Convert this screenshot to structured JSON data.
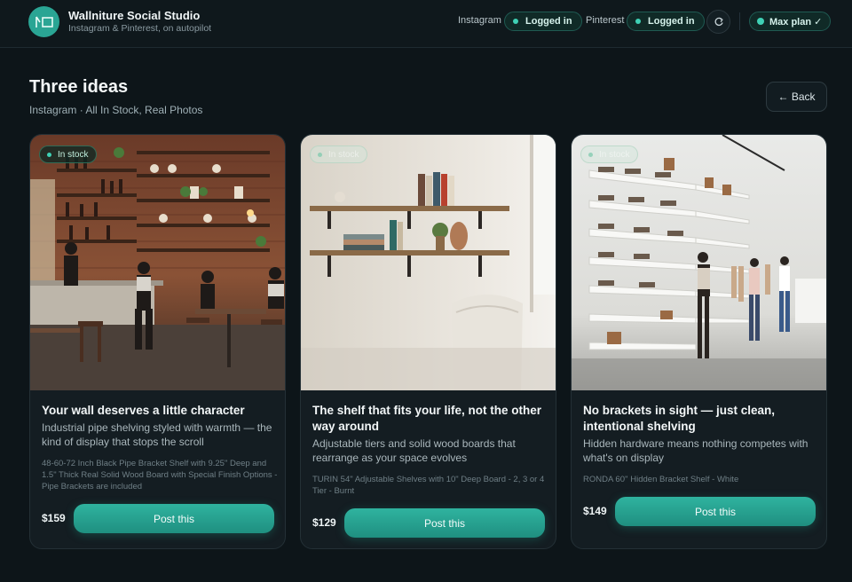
{
  "app": {
    "title": "Wallniture Social Studio",
    "subtitle": "Instagram & Pinterest, on autopilot"
  },
  "accounts": [
    {
      "name": "Instagram",
      "status": "Logged in"
    },
    {
      "name": "Pinterest",
      "status": "Logged in"
    }
  ],
  "plan": {
    "label": "Max plan ✓"
  },
  "page": {
    "title": "Three ideas",
    "subtitle": "Instagram · All In Stock, Real Photos",
    "back_label": "← Back"
  },
  "cards": [
    {
      "badge": "In stock",
      "title": "Your wall deserves a little character",
      "description": "Industrial pipe shelving styled with warmth — the kind of display that stops the scroll",
      "product": "48-60-72 Inch Black Pipe Bracket Shelf with 9.25\" Deep and 1.5\" Thick Real Solid Wood Board with Special Finish Options - Pipe Brackets are included",
      "price": "$159",
      "button": "Post this"
    },
    {
      "badge": "In stock",
      "title": "The shelf that fits your life, not the other way around",
      "description": "Adjustable tiers and solid wood boards that rearrange as your space evolves",
      "product": "TURIN 54\" Adjustable Shelves with 10\" Deep Board - 2, 3 or 4 Tier - Burnt",
      "price": "$129",
      "button": "Post this"
    },
    {
      "badge": "In stock",
      "title": "No brackets in sight — just clean, intentional shelving",
      "description": "Hidden hardware means nothing competes with what's on display",
      "product": "RONDA 60'' Hidden Bracket Shelf - White",
      "price": "$149",
      "button": "Post this"
    }
  ],
  "colors": {
    "accent": "#2aa594",
    "background": "#0d1519",
    "card": "#141d22",
    "status_dot": "#3fd1b5"
  }
}
